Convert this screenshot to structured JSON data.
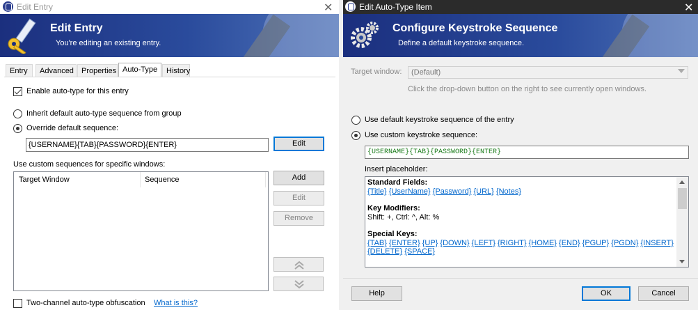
{
  "left_window": {
    "title": "Edit Entry",
    "banner_title": "Edit Entry",
    "banner_subtitle": "You're editing an existing entry.",
    "tabs": [
      "Entry",
      "Advanced",
      "Properties",
      "Auto-Type",
      "History"
    ],
    "active_tab": "Auto-Type",
    "enable_autotype_label": "Enable auto-type for this entry",
    "enable_autotype_checked": true,
    "inherit_label": "Inherit default auto-type sequence from group",
    "override_label": "Override default sequence:",
    "override_selected": true,
    "sequence_value": "{USERNAME}{TAB}{PASSWORD}{ENTER}",
    "edit_button": "Edit",
    "custom_windows_label": "Use custom sequences for specific windows:",
    "columns": [
      "Target Window",
      "Sequence"
    ],
    "add_button": "Add",
    "edit2_button": "Edit",
    "remove_button": "Remove",
    "two_channel_label": "Two-channel auto-type obfuscation",
    "two_channel_checked": false,
    "what_is_this_link": "What is this?"
  },
  "right_window": {
    "title": "Edit Auto-Type Item",
    "banner_title": "Configure Keystroke Sequence",
    "banner_subtitle": "Define a default keystroke sequence.",
    "target_window_label": "Target window:",
    "target_window_value": "(Default)",
    "hint": "Click the drop-down button on the right to see currently open windows.",
    "use_default_label": "Use default keystroke sequence of the entry",
    "use_custom_label": "Use custom keystroke sequence:",
    "custom_selected": true,
    "custom_sequence": "{USERNAME}{TAB}{PASSWORD}{ENTER}",
    "insert_placeholder_label": "Insert placeholder:",
    "standard_fields_heading": "Standard Fields:",
    "standard_fields": [
      "{Title}",
      "{UserName}",
      "{Password}",
      "{URL}",
      "{Notes}"
    ],
    "key_modifiers_heading": "Key Modifiers:",
    "key_modifiers_text": "Shift: +, Ctrl: ^, Alt: %",
    "special_keys_heading": "Special Keys:",
    "special_keys_line1": [
      "{TAB}",
      "{ENTER}",
      "{UP}",
      "{DOWN}",
      "{LEFT}",
      "{RIGHT}",
      "{HOME}",
      "{END}",
      "{PGUP}",
      "{PGDN}",
      "{INSERT}"
    ],
    "special_keys_line2": [
      "{DELETE}",
      "{SPACE}"
    ],
    "help_button": "Help",
    "ok_button": "OK",
    "cancel_button": "Cancel"
  },
  "colors": {
    "banner_dark": "#1b2f7e",
    "banner_light": "#4e72b8",
    "link": "#0066cc",
    "sequence_text": "#1a7b1a",
    "right_titlebar": "#2b2b2b"
  },
  "icons": {
    "left_banner": "pen-key-icon",
    "right_banner": "gears-icon",
    "app": "keepass-lock-icon"
  }
}
